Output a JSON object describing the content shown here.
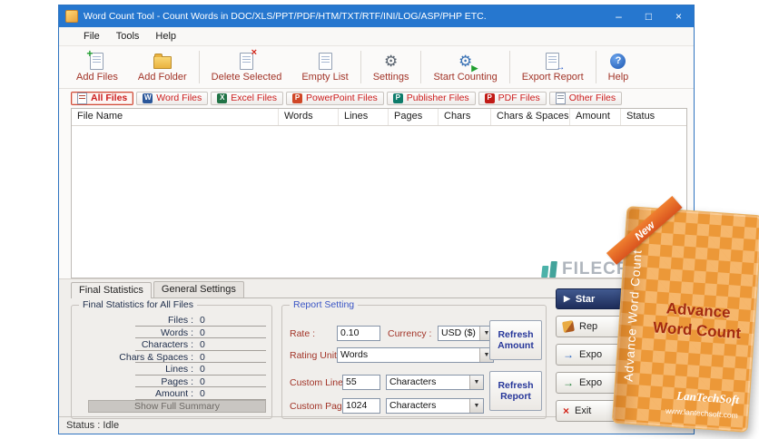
{
  "window": {
    "title": "Word Count Tool - Count Words in DOC/XLS/PPT/PDF/HTM/TXT/RTF/INI/LOG/ASP/PHP ETC.",
    "controls": {
      "minimize": "–",
      "maximize": "□",
      "close": "×"
    }
  },
  "menu": {
    "items": [
      {
        "label": "File"
      },
      {
        "label": "Tools"
      },
      {
        "label": "Help"
      }
    ]
  },
  "toolbar": {
    "items": [
      {
        "label": "Add Files",
        "icon": "add-file-icon"
      },
      {
        "label": "Add Folder",
        "icon": "add-folder-icon"
      },
      {
        "label": "Delete Selected",
        "icon": "delete-selected-icon"
      },
      {
        "label": "Empty List",
        "icon": "empty-list-icon"
      },
      {
        "label": "Settings",
        "icon": "settings-gear-icon"
      },
      {
        "label": "Start Counting",
        "icon": "start-counting-icon"
      },
      {
        "label": "Export Report",
        "icon": "export-report-icon"
      },
      {
        "label": "Help",
        "icon": "help-icon"
      }
    ]
  },
  "filters": {
    "items": [
      {
        "label": "All Files",
        "active": true,
        "badge": ""
      },
      {
        "label": "Word Files",
        "active": false,
        "badge": "W"
      },
      {
        "label": "Excel Files",
        "active": false,
        "badge": "X"
      },
      {
        "label": "PowerPoint Files",
        "active": false,
        "badge": "P"
      },
      {
        "label": "Publisher Files",
        "active": false,
        "badge": "P"
      },
      {
        "label": "PDF Files",
        "active": false,
        "badge": "P"
      },
      {
        "label": "Other Files",
        "active": false,
        "badge": ""
      }
    ]
  },
  "table": {
    "columns": [
      "File Name",
      "Words",
      "Lines",
      "Pages",
      "Chars",
      "Chars & Spaces",
      "Amount",
      "Status"
    ],
    "rows": []
  },
  "bottom": {
    "tabs": [
      {
        "label": "Final Statistics",
        "active": true
      },
      {
        "label": "General Settings",
        "active": false
      }
    ],
    "stats": {
      "group_title": "Final Statistics for All Files",
      "rows": [
        {
          "label": "Files :",
          "value": "0"
        },
        {
          "label": "Words :",
          "value": "0"
        },
        {
          "label": "Characters :",
          "value": "0"
        },
        {
          "label": "Chars & Spaces :",
          "value": "0"
        },
        {
          "label": "Lines :",
          "value": "0"
        },
        {
          "label": "Pages :",
          "value": "0"
        },
        {
          "label": "Amount :",
          "value": "0"
        }
      ],
      "summary_button": "Show Full Summary"
    },
    "report": {
      "group_title": "Report Setting",
      "rate_label": "Rate :",
      "rate_value": "0.10",
      "currency_label": "Currency :",
      "currency_value": "USD ($)",
      "rating_unit_label": "Rating Unit :",
      "rating_unit_value": "Words",
      "custom_line_label": "Custom Line :",
      "custom_line_value": "55",
      "custom_line_unit": "Characters",
      "custom_page_label": "Custom Page :",
      "custom_page_value": "1024",
      "custom_page_unit": "Characters",
      "refresh_amount_button": "Refresh Amount",
      "refresh_report_button": "Refresh Report"
    },
    "side_buttons": [
      {
        "label": "Star"
      },
      {
        "label": "Rep"
      },
      {
        "label": "Expo"
      },
      {
        "label": "Expo"
      },
      {
        "label": "Exit"
      }
    ]
  },
  "promo": {
    "ribbon": "New",
    "side_text": "Advance Word Count",
    "title_line1": "Advance",
    "title_line2": "Word Count",
    "brand": "LanTechSoft",
    "url": "www.lantechsoft.com"
  },
  "watermark": {
    "text": "FILECR"
  },
  "statusbar": {
    "text": "Status : Idle"
  },
  "colors": {
    "titlebar": "#2677cf",
    "toolbar_label": "#a23428",
    "filter_label": "#cc1d1d",
    "report_legend": "#3a55c5",
    "promo_orange": "#ec9838"
  }
}
